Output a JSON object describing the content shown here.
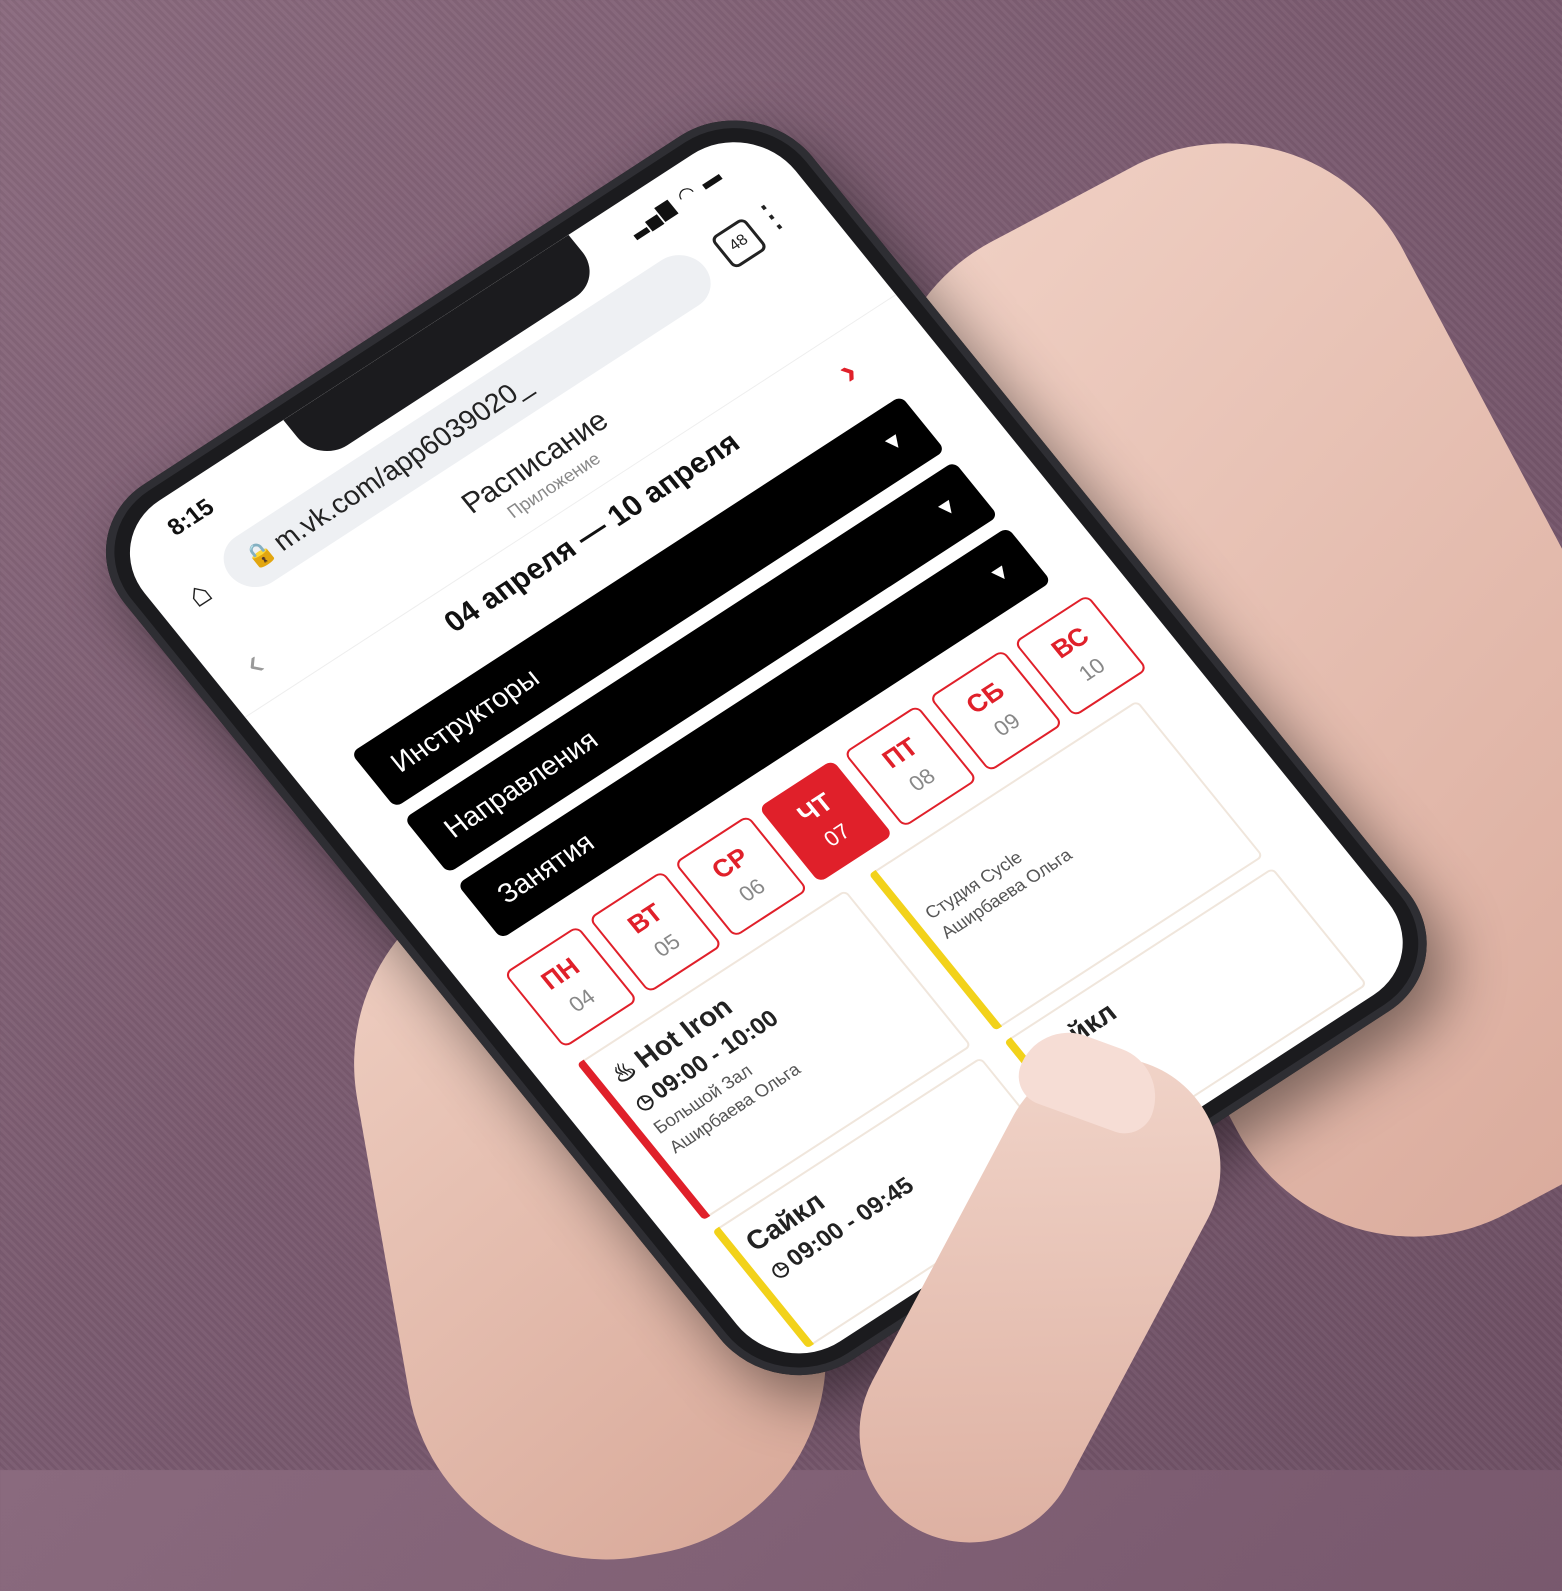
{
  "status": {
    "time": "8:15",
    "signal": "▂▄▆ ◠ ▬"
  },
  "browser": {
    "url": "m.vk.com/app6039020_",
    "tabs_count": "48"
  },
  "app": {
    "title": "Расписание",
    "subtitle": "Приложение"
  },
  "week": {
    "range": "04 апреля — 10 апреля"
  },
  "filters": [
    {
      "label": "Инструкторы"
    },
    {
      "label": "Направления"
    },
    {
      "label": "Занятия"
    }
  ],
  "days": [
    {
      "name": "ПН",
      "num": "04",
      "active": false
    },
    {
      "name": "ВТ",
      "num": "05",
      "active": false
    },
    {
      "name": "СР",
      "num": "06",
      "active": false
    },
    {
      "name": "ЧТ",
      "num": "07",
      "active": true
    },
    {
      "name": "ПТ",
      "num": "08",
      "active": false
    },
    {
      "name": "СБ",
      "num": "09",
      "active": false
    },
    {
      "name": "ВС",
      "num": "10",
      "active": false
    }
  ],
  "cards": [
    {
      "title": "Hot Iron",
      "time": "09:00 - 10:00",
      "room": "Большой Зал",
      "instructor": "Аширбаева Ольга",
      "accent": "#e0202a"
    },
    {
      "title": "Сайкл",
      "time": "09:00 - 09:45",
      "room": "",
      "instructor": "",
      "accent": "#f2d21a"
    },
    {
      "title": "",
      "time": "",
      "room": "Студия Cycle",
      "instructor": "Аширбаева Ольга",
      "accent": "#f2d21a"
    },
    {
      "title": "Сайкл",
      "time": "",
      "room": "",
      "instructor": "",
      "accent": "#f2d21a"
    }
  ],
  "colors": {
    "accent": "#e0202a",
    "bar_yellow": "#f2d21a",
    "background": "#7b5b70"
  }
}
